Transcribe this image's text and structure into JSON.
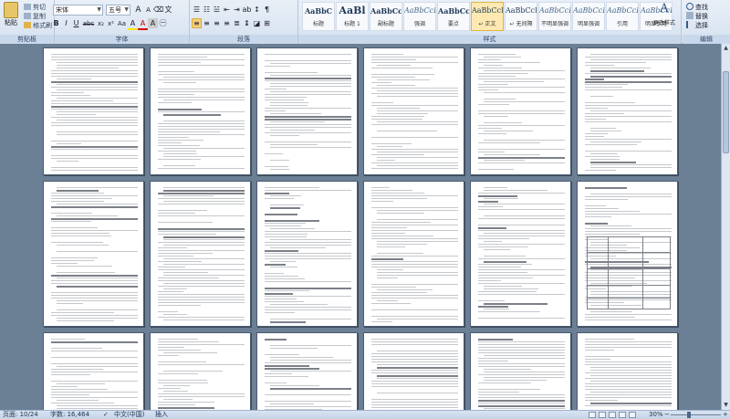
{
  "clipboard": {
    "paste": "粘贴",
    "cut": "剪切",
    "copy": "复制",
    "format_painter": "格式刷",
    "group_label": "剪贴板"
  },
  "font": {
    "font_name": "宋体",
    "font_size": "五号",
    "grow": "A",
    "shrink": "A",
    "bold": "B",
    "italic": "I",
    "underline": "U",
    "strike": "abc",
    "subscript": "x₂",
    "superscript": "x²",
    "change_case": "Aa",
    "highlight": "A",
    "font_color": "A",
    "group_label": "字体"
  },
  "paragraph": {
    "group_label": "段落"
  },
  "styles": {
    "group_label": "样式",
    "items": [
      {
        "sample": "AaBbC",
        "name": "标题"
      },
      {
        "sample": "AaBl",
        "name": "标题 1"
      },
      {
        "sample": "AaBbCc",
        "name": "副标题"
      },
      {
        "sample": "AaBbCcD",
        "name": "强调"
      },
      {
        "sample": "AaBbCcD",
        "name": "要点"
      },
      {
        "sample": "AaBbCcDc",
        "name": "↵ 正文"
      },
      {
        "sample": "AaBbCcDc",
        "name": "↵ 无间隔"
      },
      {
        "sample": "AaBbCcDc",
        "name": "不明显强调"
      },
      {
        "sample": "AaBbCcDc",
        "name": "明显强调"
      },
      {
        "sample": "AaBbCcDc",
        "name": "引用"
      },
      {
        "sample": "AaBbCcDc",
        "name": "明显引用"
      }
    ],
    "change_styles": "更改样式",
    "change_styles_icon": "A"
  },
  "editing": {
    "group_label": "编辑",
    "find": "查找",
    "replace": "替换",
    "select": "选择"
  },
  "status": {
    "page": "页面: 10/24",
    "words": "字数: 16,464",
    "language": "中文(中国)",
    "insert": "插入",
    "zoom": "30%"
  }
}
